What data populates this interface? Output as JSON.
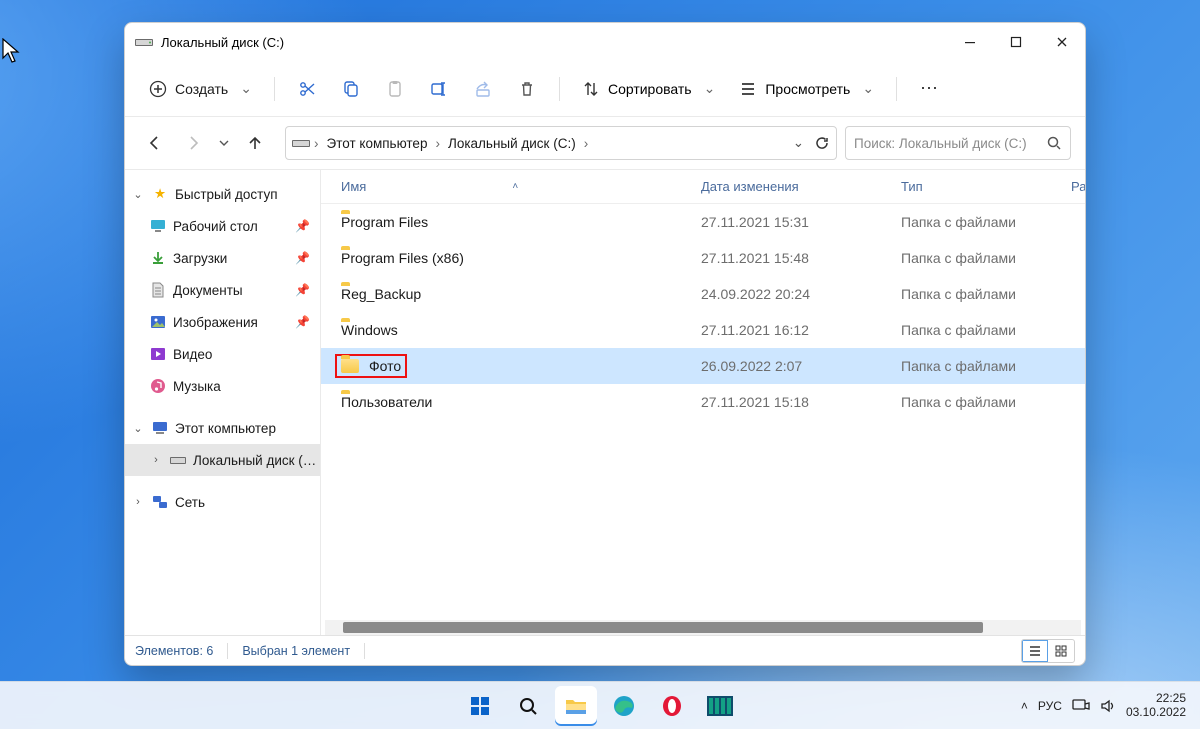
{
  "window": {
    "title": "Локальный диск (C:)"
  },
  "toolbar": {
    "new_label": "Создать",
    "sort_label": "Сортировать",
    "view_label": "Просмотреть"
  },
  "breadcrumb": {
    "root": "Этот компьютер",
    "current": "Локальный диск (C:)"
  },
  "search": {
    "placeholder": "Поиск: Локальный диск (C:)"
  },
  "sidebar": {
    "quick_access": "Быстрый доступ",
    "items": [
      {
        "label": "Рабочий стол",
        "icon": "desktop"
      },
      {
        "label": "Загрузки",
        "icon": "downloads"
      },
      {
        "label": "Документы",
        "icon": "documents"
      },
      {
        "label": "Изображения",
        "icon": "pictures"
      },
      {
        "label": "Видео",
        "icon": "videos"
      },
      {
        "label": "Музыка",
        "icon": "music"
      }
    ],
    "this_pc": "Этот компьютер",
    "drive": "Локальный диск (C:)",
    "network": "Сеть"
  },
  "columns": {
    "name": "Имя",
    "date": "Дата изменения",
    "type": "Тип",
    "size": "Раз"
  },
  "rows": [
    {
      "name": "Program Files",
      "date": "27.11.2021 15:31",
      "type": "Папка с файлами",
      "selected": false,
      "highlight": false
    },
    {
      "name": "Program Files (x86)",
      "date": "27.11.2021 15:48",
      "type": "Папка с файлами",
      "selected": false,
      "highlight": false
    },
    {
      "name": "Reg_Backup",
      "date": "24.09.2022 20:24",
      "type": "Папка с файлами",
      "selected": false,
      "highlight": false
    },
    {
      "name": "Windows",
      "date": "27.11.2021 16:12",
      "type": "Папка с файлами",
      "selected": false,
      "highlight": false
    },
    {
      "name": "Фото",
      "date": "26.09.2022 2:07",
      "type": "Папка с файлами",
      "selected": true,
      "highlight": true
    },
    {
      "name": "Пользователи",
      "date": "27.11.2021 15:18",
      "type": "Папка с файлами",
      "selected": false,
      "highlight": false
    }
  ],
  "status": {
    "items": "Элементов: 6",
    "selection": "Выбран 1 элемент"
  },
  "tray": {
    "lang": "РУС",
    "time": "22:25",
    "date": "03.10.2022"
  }
}
